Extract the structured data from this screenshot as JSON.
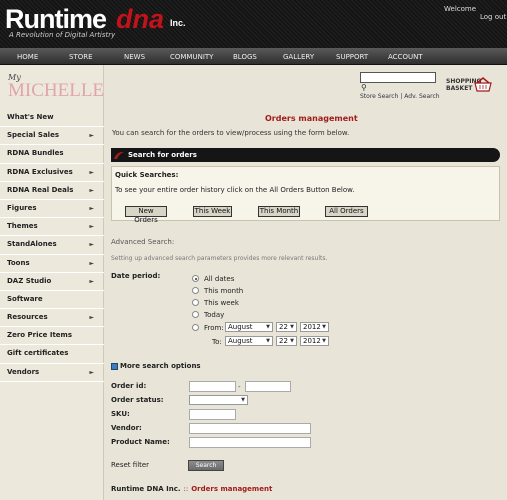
{
  "header": {
    "logo_main": "Runtime",
    "logo_dna": "dna",
    "logo_inc": "Inc.",
    "tagline": "A Revolution of Digital Artistry",
    "welcome": "Welcome",
    "logout": "Log out"
  },
  "nav": [
    "HOME",
    "STORE",
    "NEWS",
    "COMMUNITY",
    "BLOGS",
    "GALLERY",
    "SUPPORT",
    "ACCOUNT"
  ],
  "sidebar": {
    "brand_my": "My",
    "brand_name": "MICHELLE",
    "items": [
      {
        "label": "What's New",
        "arrow": false
      },
      {
        "label": "Special Sales",
        "arrow": true
      },
      {
        "label": "RDNA Bundles",
        "arrow": false
      },
      {
        "label": "RDNA Exclusives",
        "arrow": true
      },
      {
        "label": "RDNA Real Deals",
        "arrow": true
      },
      {
        "label": "Figures",
        "arrow": true
      },
      {
        "label": "Themes",
        "arrow": true
      },
      {
        "label": "StandAlones",
        "arrow": true
      },
      {
        "label": "Toons",
        "arrow": true
      },
      {
        "label": "DAZ Studio",
        "arrow": true
      },
      {
        "label": "Software",
        "arrow": false
      },
      {
        "label": "Resources",
        "arrow": true
      },
      {
        "label": "Zero Price Items",
        "arrow": false
      },
      {
        "label": "Gift certificates",
        "arrow": false
      },
      {
        "label": "Vendors",
        "arrow": true
      }
    ]
  },
  "store_search": {
    "store_search": "Store Search",
    "separator": "|",
    "adv_search": "Adv. Search",
    "basket_line1": "SHOPPING",
    "basket_line2": "BASKET"
  },
  "main": {
    "title": "Orders management",
    "intro": "You can search for the orders to view/process using the form below.",
    "section_title": "Search for orders",
    "quick_title": "Quick Searches:",
    "quick_text": "To see your entire order history click on the All Orders Button Below.",
    "quick_buttons": [
      "New Orders",
      "This Week",
      "This Month",
      "All Orders"
    ],
    "adv_title": "Advanced Search:",
    "adv_sub": "Setting up advanced search parameters provides more relevant results.",
    "date_period_label": "Date period:",
    "date_options": [
      "All dates",
      "This month",
      "This week",
      "Today"
    ],
    "date_selected": "All dates",
    "from_label": "From:",
    "to_label": "To:",
    "from": {
      "month": "August",
      "day": "22",
      "year": "2012"
    },
    "to": {
      "month": "August",
      "day": "22",
      "year": "2012"
    },
    "more_options": "More search options",
    "order_id_label": "Order id:",
    "order_id_sep": "-",
    "order_status_label": "Order status:",
    "sku_label": "SKU:",
    "vendor_label": "Vendor:",
    "product_name_label": "Product Name:",
    "reset_label": "Reset filter",
    "search_label": "Search"
  },
  "breadcrumb": {
    "home": "Runtime DNA Inc.",
    "sep": "::",
    "current": "Orders management"
  },
  "colors": {
    "accent_red": "#a21c1c",
    "header_bg": "#1a1a1a",
    "page_bg": "#e8e4d8"
  }
}
